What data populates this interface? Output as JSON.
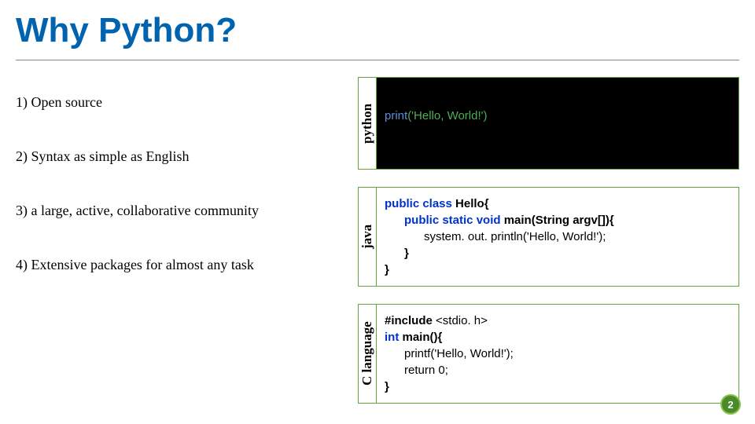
{
  "title": "Why Python?",
  "points": {
    "p1": "1) Open source",
    "p2": "2) Syntax as simple as English",
    "p3": "3) a large, active, collaborative community",
    "p4": "4) Extensive packages for almost any task"
  },
  "labels": {
    "python": "python",
    "java": "java",
    "c": "C language"
  },
  "code": {
    "python": {
      "fn": "print",
      "arg": "('Hello, World!')"
    },
    "java": {
      "l1a": "public class ",
      "l1b": "Hello{",
      "l2a": "      public static void ",
      "l2b": "main(String ",
      "l2c": "argv[]){",
      "l3": "            system. out. println('Hello, World!');",
      "l4": "      }",
      "l5": "}"
    },
    "c": {
      "l1a": "#include",
      "l1b": " <stdio. h>",
      "l2a": "int ",
      "l2b": "main(){",
      "l3": "      printf('Hello, World!');",
      "l4": "      return 0;",
      "l5": "}"
    }
  },
  "page_number": "2"
}
